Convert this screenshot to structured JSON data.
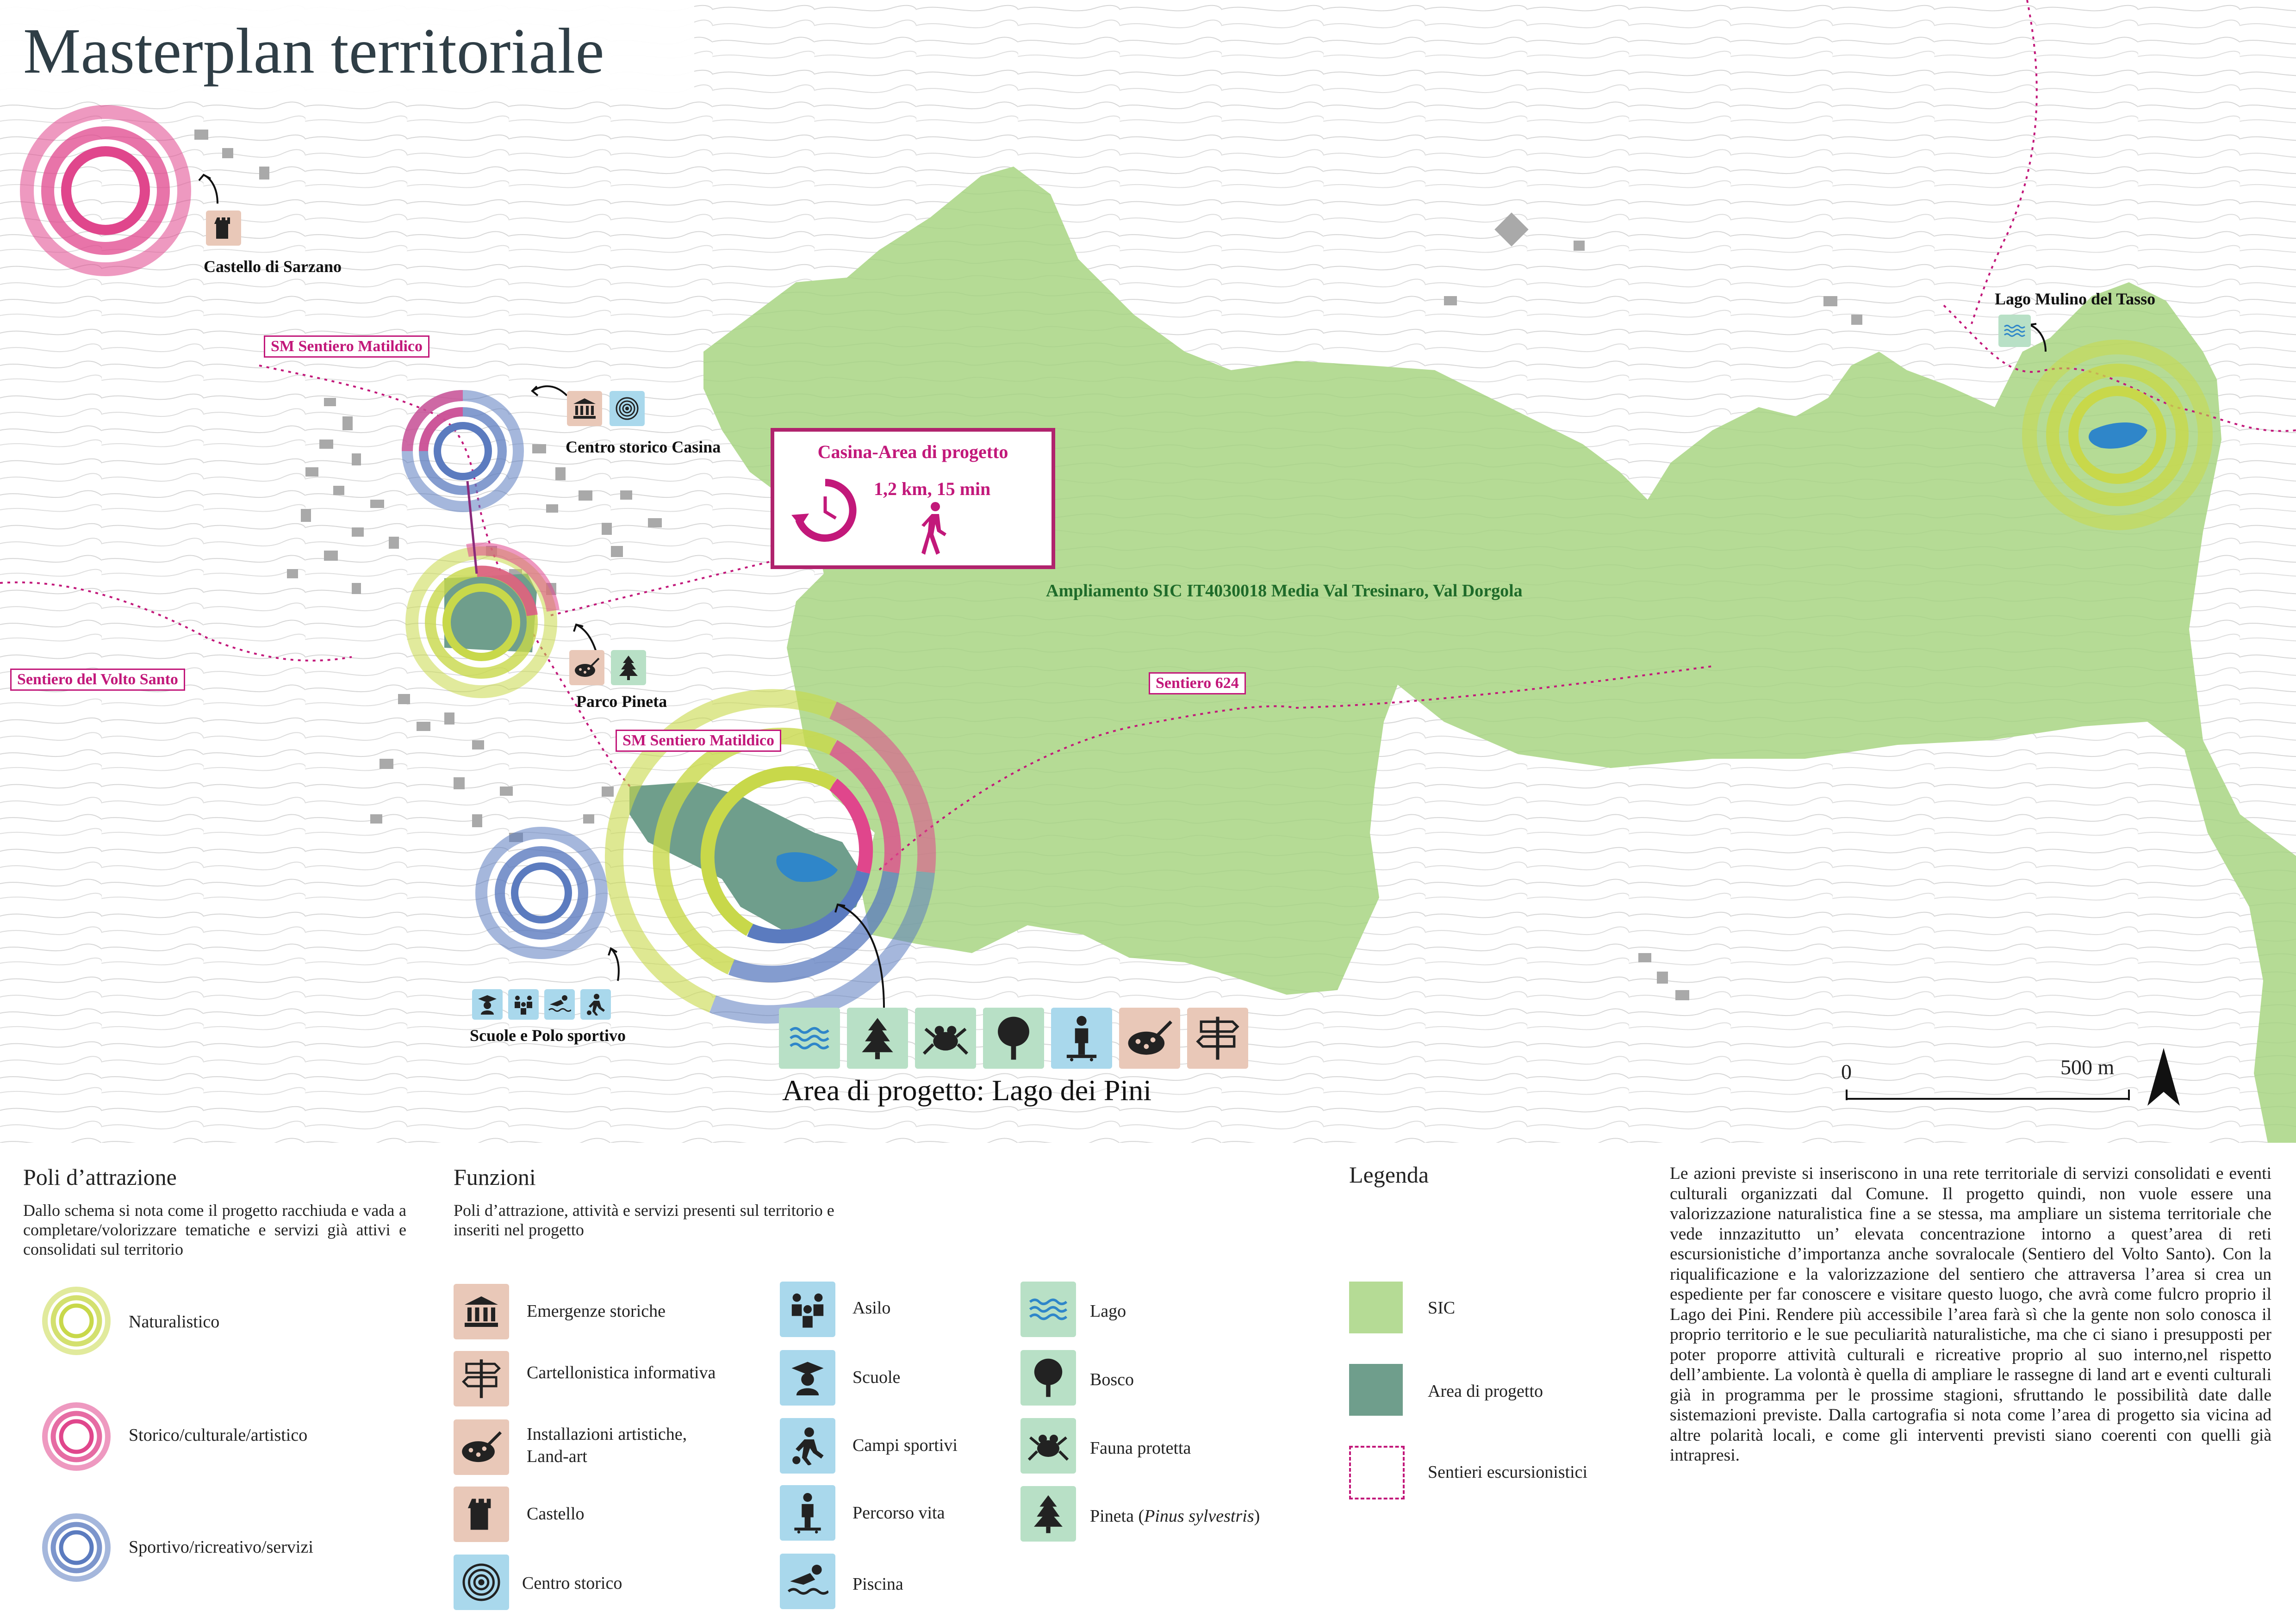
{
  "title": "Masterplan territoriale",
  "map": {
    "labels": {
      "castello": "Castello di Sarzano",
      "centro_storico": "Centro storico Casina",
      "parco_pineta": "Parco Pineta",
      "scuole": "Scuole e Polo sportivo",
      "lago_mulino": "Lago Mulino del Tasso",
      "sic": "Ampliamento SIC IT4030018 Media Val Tresinaro, Val Dorgola"
    },
    "paths": {
      "sm_top": "SM Sentiero Matildico",
      "sm_mid": "SM Sentiero Matildico",
      "volto_santo": "Sentiero del Volto Santo",
      "s624": "Sentiero 624"
    },
    "project_box": {
      "heading": "Casina-Area di progetto",
      "detail": "1,2 km, 15 min"
    },
    "area_title": "Area di progetto: Lago dei Pini",
    "scale": {
      "zero": "0",
      "end": "500 m"
    },
    "icons": {
      "castello": [
        "tower-icon"
      ],
      "centro": [
        "museum-icon",
        "target-icon"
      ],
      "parco": [
        "palette-icon",
        "pine-icon"
      ],
      "scuole": [
        "school-icon",
        "kids-icon",
        "swim-icon",
        "sport-icon"
      ],
      "lago_mulino": [
        "water-icon"
      ],
      "area": [
        "water-icon",
        "pine-icon",
        "frog-icon",
        "tree-icon",
        "fitness-icon",
        "palette-icon",
        "signpost-icon"
      ]
    }
  },
  "poli": {
    "heading": "Poli d’attrazione",
    "text": "Dallo schema si nota come il progetto racchiuda e vada a completare/volorizzare tematiche e servizi già attivi e consolidati sul territorio",
    "items": [
      {
        "label": "Naturalistico",
        "color": "#c8d84a"
      },
      {
        "label": "Storico/culturale/artistico",
        "color": "#e0468c"
      },
      {
        "label": "Sportivo/ricreativo/servizi",
        "color": "#5b7bbf"
      }
    ]
  },
  "funzioni": {
    "heading": "Funzioni",
    "text": "Poli d’attrazione, attività e servizi presenti sul territorio e inseriti nel progetto",
    "col1": [
      {
        "label": "Emergenze storiche",
        "icon": "museum-icon"
      },
      {
        "label": "Cartellonistica informativa",
        "icon": "signpost-icon"
      },
      {
        "label": "Installazioni artistiche,",
        "label2": "Land-art",
        "icon": "palette-icon"
      },
      {
        "label": "Castello",
        "icon": "tower-icon"
      },
      {
        "label": "Centro storico",
        "icon": "target-icon"
      }
    ],
    "col2": [
      {
        "label": "Asilo",
        "icon": "kids-icon"
      },
      {
        "label": "Scuole",
        "icon": "school-icon"
      },
      {
        "label": "Campi sportivi",
        "icon": "sport-icon"
      },
      {
        "label": "Percorso vita",
        "icon": "fitness-icon"
      },
      {
        "label": "Piscina",
        "icon": "swim-icon"
      }
    ],
    "col3": [
      {
        "label": "Lago",
        "icon": "water-icon"
      },
      {
        "label": "Bosco",
        "icon": "tree-icon"
      },
      {
        "label": "Fauna protetta",
        "icon": "frog-icon"
      },
      {
        "label": "Pineta (",
        "italic": "Pinus sylvestris",
        "label_end": ")",
        "icon": "pine-icon"
      }
    ]
  },
  "legenda": {
    "heading": "Legenda",
    "items": [
      {
        "label": "SIC",
        "color": "#b5db95"
      },
      {
        "label": "Area di progetto",
        "color": "#6f9e8c"
      },
      {
        "label": "Sentieri escursionistici",
        "color": "#c2187a"
      }
    ]
  },
  "description": "Le azioni previste si inseriscono in una rete territoriale di servizi consolidati e eventi culturali organizzati dal Comune. Il progetto quindi, non vuole essere una valorizzazione naturalistica fine a se stessa, ma ampliare un sistema territoriale che vede innzazitutto un’ elevata concentrazione intorno a quest’area di reti escursionistiche d’importanza anche sovralocale (Sentiero del Volto Santo). Con la riqualificazione e la valorizzazione del sentiero che attraversa l’area si crea un espediente per far conoscere e visitare questo luogo, che avrà come fulcro proprio il Lago dei Pini. Rendere più accessibile l’area farà sì che la gente non solo conosca il proprio territorio e le sue peculiarità naturalistiche, ma che ci siano i presupposti per poter proporre attività culturali e ricreative proprio al suo interno,nel rispetto dell’ambiente. La volontà è quella di ampliare le rassegne di land art e eventi culturali già in programma per le prossime stagioni, sfruttando le possibilità date dalle sistemazioni previste. Dalla cartografia si nota come l’area di progetto sia vicina ad altre polarità locali, e come gli interventi previsti siano coerenti con quelli già intrapresi.",
  "colors": {
    "sic": "#b5db95",
    "project_area": "#6f9e8c",
    "naturalistic": "#c8d84a",
    "historic": "#e0468c",
    "sport": "#5b7bbf",
    "path": "#c2187a"
  }
}
